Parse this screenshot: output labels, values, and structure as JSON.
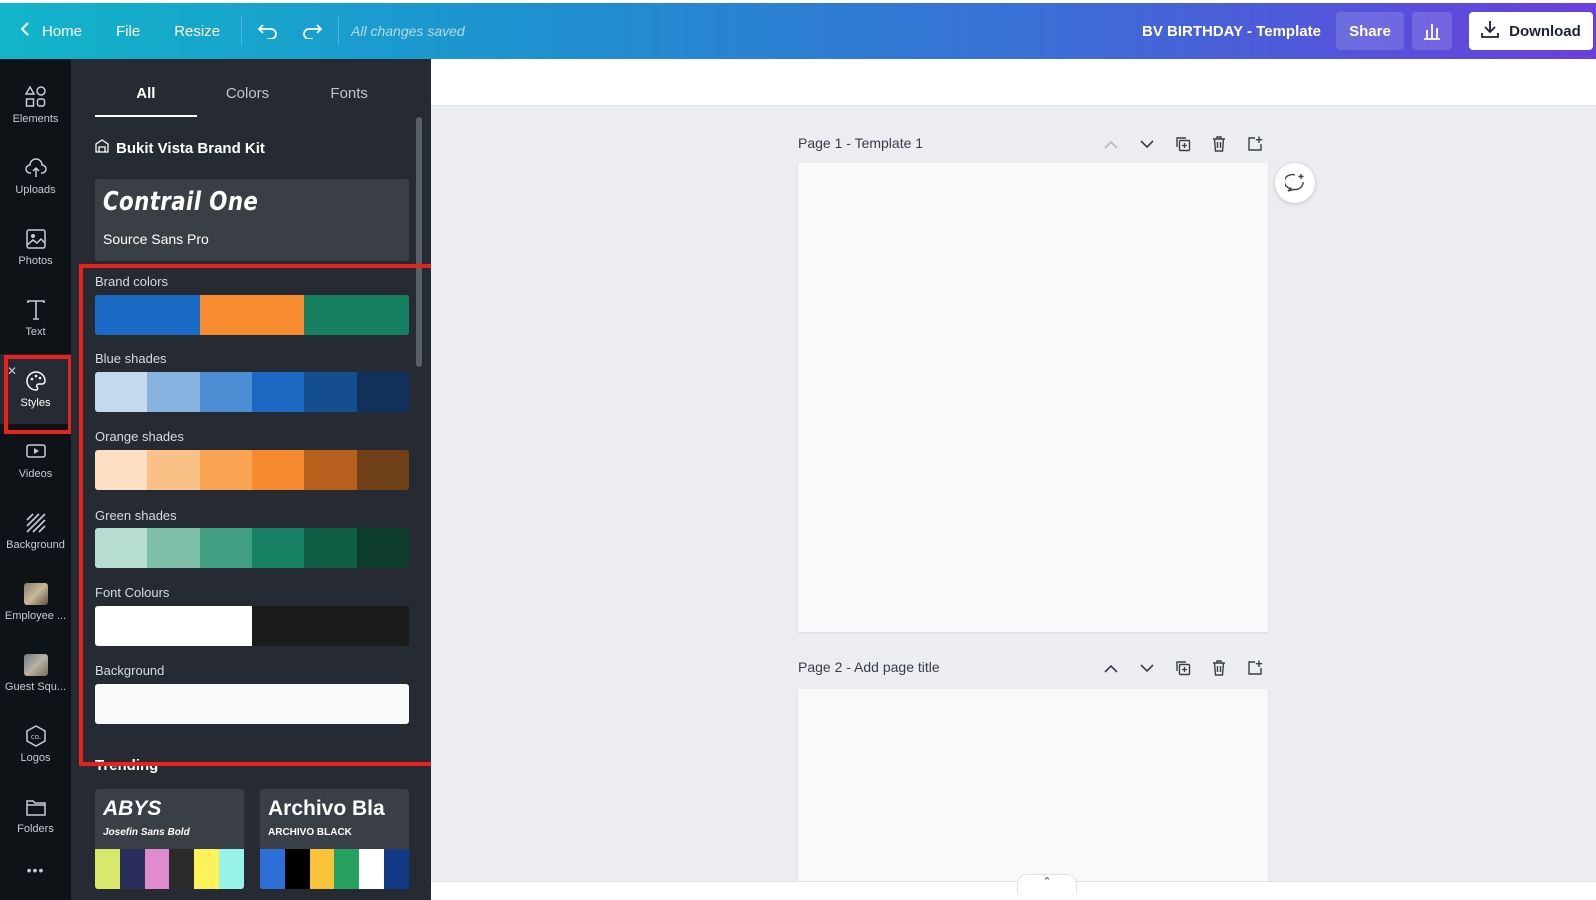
{
  "topbar": {
    "home": "Home",
    "file": "File",
    "resize": "Resize",
    "saved_status": "All changes saved",
    "title": "BV BIRTHDAY - Template",
    "share": "Share",
    "download": "Download"
  },
  "rail": {
    "items": [
      {
        "label": "Elements",
        "icon": "elements-icon"
      },
      {
        "label": "Uploads",
        "icon": "upload-cloud-icon"
      },
      {
        "label": "Photos",
        "icon": "photo-icon"
      },
      {
        "label": "Text",
        "icon": "text-icon"
      },
      {
        "label": "Styles",
        "icon": "palette-icon"
      },
      {
        "label": "Videos",
        "icon": "video-icon"
      },
      {
        "label": "Background",
        "icon": "background-icon"
      },
      {
        "label": "Employee ...",
        "icon": "folder-thumb"
      },
      {
        "label": "Guest Squ...",
        "icon": "folder-thumb"
      },
      {
        "label": "Logos",
        "icon": "logo-icon"
      },
      {
        "label": "Folders",
        "icon": "folder-icon"
      }
    ],
    "more": "•••"
  },
  "panel": {
    "tabs": [
      "All",
      "Colors",
      "Fonts"
    ],
    "brand_kit": "Bukit Vista Brand Kit",
    "font_card": {
      "heading": "Contrail One",
      "body": "Source Sans Pro"
    },
    "palettes": [
      {
        "label": "Brand colors",
        "colors": [
          "#1b6bc6",
          "#f68b30",
          "#178060"
        ]
      },
      {
        "label": "Blue shades",
        "colors": [
          "#c2d9ef",
          "#87b3e0",
          "#4c8ed3",
          "#1a68c2",
          "#144e8f",
          "#11305a"
        ]
      },
      {
        "label": "Orange shades",
        "colors": [
          "#fde0c4",
          "#fbc085",
          "#f8a453",
          "#f58a2e",
          "#b8611f",
          "#6f4018"
        ]
      },
      {
        "label": "Green shades",
        "colors": [
          "#b8ddd2",
          "#7ebfaa",
          "#409f82",
          "#188264",
          "#115e47",
          "#0d3b2d"
        ]
      },
      {
        "label": "Font Colours",
        "colors": [
          "#ffffff",
          "#1c1c1c"
        ]
      },
      {
        "label": "Background",
        "colors": [
          "#f8f9fb"
        ]
      }
    ],
    "trending": "Trending",
    "kits": [
      {
        "heading": "ABYS",
        "sub": "Josefin Sans Bold",
        "colors": [
          "#d9e86c",
          "#2a2e5a",
          "#e08bd0",
          "#2a2a2a",
          "#fdf25a",
          "#98f2e8"
        ]
      },
      {
        "heading": "Archivo Bla",
        "sub": "ARCHIVO BLACK",
        "colors": [
          "#2d6fd6",
          "#000000",
          "#f8c33a",
          "#26a05e",
          "#ffffff",
          "#123a86"
        ]
      }
    ]
  },
  "canvas": {
    "pages": [
      {
        "label": "Page 1 - ",
        "title": "Template 1"
      },
      {
        "label": "Page 2 - ",
        "title": "Add page title"
      }
    ]
  }
}
